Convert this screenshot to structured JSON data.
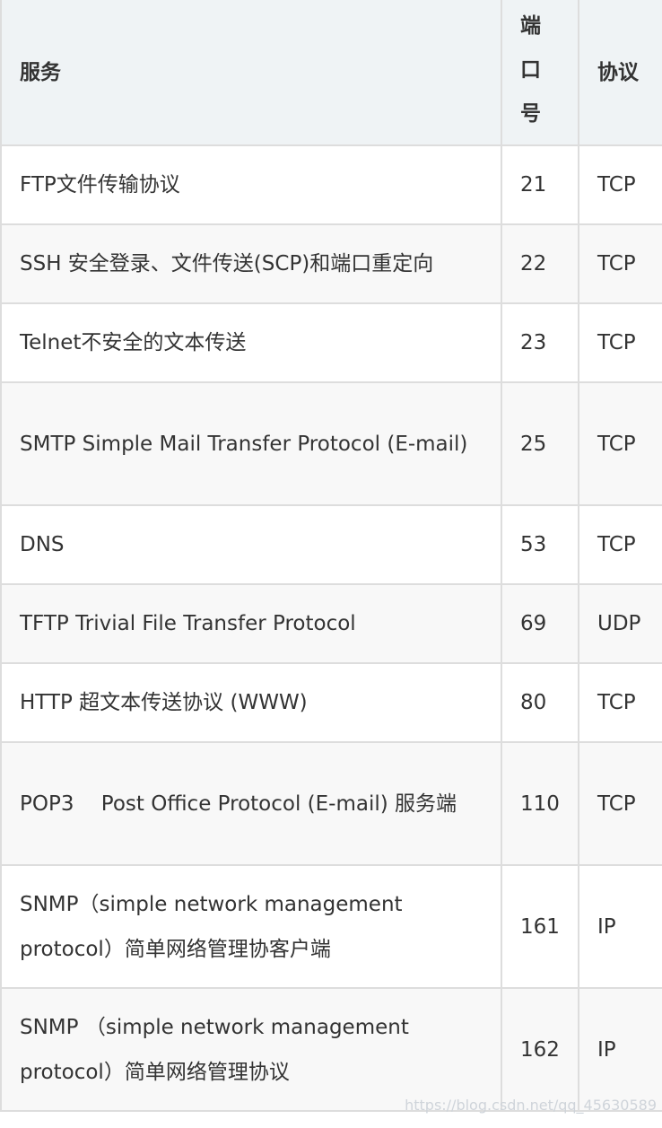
{
  "header": {
    "service": "服务",
    "port_chars": [
      "端",
      "口",
      "号"
    ],
    "protocol": "协议"
  },
  "rows": [
    {
      "service": "FTP文件传输协议",
      "port": "21",
      "protocol": "TCP",
      "tall": false
    },
    {
      "service": "SSH 安全登录、文件传送(SCP)和端口重定向",
      "port": "22",
      "protocol": "TCP",
      "tall": false
    },
    {
      "service": "Telnet不安全的文本传送",
      "port": "23",
      "protocol": "TCP",
      "tall": false
    },
    {
      "service": "SMTP Simple Mail Transfer Protocol (E-mail)",
      "port": "25",
      "protocol": "TCP",
      "tall": true
    },
    {
      "service": "DNS",
      "port": "53",
      "protocol": "TCP",
      "tall": false
    },
    {
      "service": "TFTP Trivial File Transfer Protocol",
      "port": "69",
      "protocol": "UDP",
      "tall": false
    },
    {
      "service": "HTTP 超文本传送协议 (WWW)",
      "port": "80",
      "protocol": "TCP",
      "tall": false
    },
    {
      "service": "POP3　 Post Office Protocol (E-mail) 服务端",
      "port": "110",
      "protocol": "TCP",
      "tall": true
    },
    {
      "service": "SNMP（simple network management protocol）简单网络管理协客户端",
      "port": "161",
      "protocol": "IP",
      "tall": true
    },
    {
      "service": "SNMP （simple network management protocol）简单网络管理协议",
      "port": "162",
      "protocol": "IP",
      "tall": true
    }
  ],
  "watermark": "https://blog.csdn.net/qq_45630589"
}
